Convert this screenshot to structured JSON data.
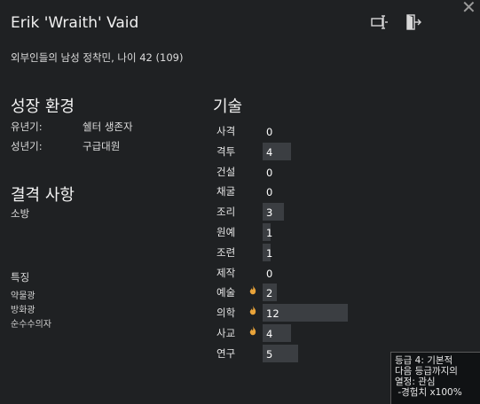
{
  "character": {
    "name": "Erik 'Wraith' Vaid",
    "description": "외부인들의 남성 정착민, 나이 42 (109)"
  },
  "header_icons": [
    "rename-icon",
    "exit-icon"
  ],
  "close_glyph": "✕",
  "backstory": {
    "title": "성장 환경",
    "childhood_label": "유년기:",
    "childhood_value": "쉘터 생존자",
    "adulthood_label": "성년기:",
    "adulthood_value": "구급대원"
  },
  "incapable": {
    "title": "결격 사항",
    "items": [
      "소방"
    ]
  },
  "traits": {
    "title": "특징",
    "items": [
      "약물광",
      "방화광",
      "순수수의자"
    ]
  },
  "skills": {
    "title": "기술",
    "max": 20,
    "items": [
      {
        "name": "사격",
        "value": 0,
        "passion": false
      },
      {
        "name": "격투",
        "value": 4,
        "passion": false
      },
      {
        "name": "건설",
        "value": 0,
        "passion": false
      },
      {
        "name": "채굴",
        "value": 0,
        "passion": false
      },
      {
        "name": "조리",
        "value": 3,
        "passion": false
      },
      {
        "name": "원예",
        "value": 1,
        "passion": false
      },
      {
        "name": "조련",
        "value": 1,
        "passion": false
      },
      {
        "name": "제작",
        "value": 0,
        "passion": false
      },
      {
        "name": "예술",
        "value": 2,
        "passion": true
      },
      {
        "name": "의학",
        "value": 12,
        "passion": true
      },
      {
        "name": "사교",
        "value": 4,
        "passion": true
      },
      {
        "name": "연구",
        "value": 5,
        "passion": false
      }
    ]
  },
  "tooltip": {
    "lines": [
      "등급 4: 기본적",
      "다음 등급까지의",
      "열정: 관심",
      " -경험치 x100%"
    ]
  },
  "colors": {
    "background": "#1f2123",
    "bar": "#3b3e42",
    "passion": "#e8a33a"
  }
}
